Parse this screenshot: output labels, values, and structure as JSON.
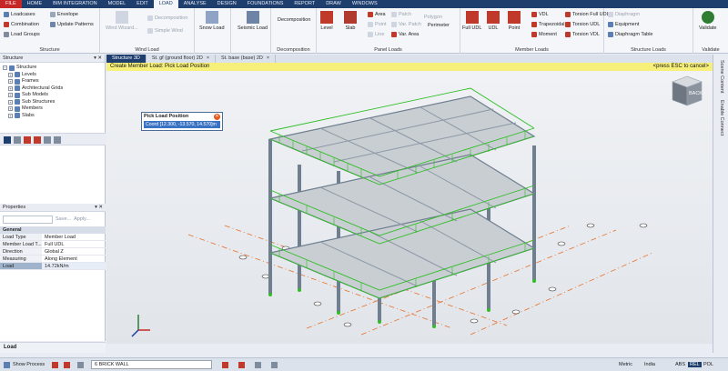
{
  "menu": [
    "FILE",
    "HOME",
    "BIM INTEGRATION",
    "MODEL",
    "EDIT",
    "LOAD",
    "ANALYSE",
    "DESIGN",
    "FOUNDATIONS",
    "REPORT",
    "DRAW",
    "WINDOWS"
  ],
  "ribbon": {
    "structure": {
      "title": "Structure",
      "items": [
        "Loadcases",
        "Combination",
        "Load Groups",
        "Envelope",
        "Update Patterns"
      ]
    },
    "wind": {
      "title": "Wind Load",
      "items": [
        "Wind Wizard...",
        "Decomposition",
        "Simple Wind"
      ]
    },
    "snow": {
      "label": "Snow Load"
    },
    "seismic": {
      "label": "Seismic Load"
    },
    "decomp": {
      "title": "Decomposition",
      "label": "Decomposition"
    },
    "panel": {
      "title": "Panel Loads",
      "items": [
        "Level",
        "Slab",
        "Area",
        "Point",
        "Line",
        "Patch",
        "Var. Patch",
        "Var. Area",
        "Polygon",
        "Perimeter"
      ]
    },
    "member": {
      "title": "Member Loads",
      "items": [
        "Full UDL",
        "UDL",
        "Point",
        "VDL",
        "Trapezoidal",
        "Moment",
        "Torsion Full UDL",
        "Torsion UDL",
        "Torsion VDL"
      ]
    },
    "struct_loads": {
      "title": "Structure Loads",
      "items": [
        "Diaphragm",
        "Equipment",
        "Diaphragm Table"
      ]
    },
    "validate": {
      "title": "Validate",
      "label": "Validate"
    }
  },
  "left": {
    "structure_title": "Structure",
    "tree": [
      "Structure",
      "Levels",
      "Frames",
      "Architectural Grids",
      "Sub Models",
      "Sub Structures",
      "Members",
      "Slabs"
    ],
    "properties_title": "Properties",
    "save": "Save...",
    "apply": "Apply...",
    "general": "General",
    "props": [
      [
        "Load Type",
        "Member Load"
      ],
      [
        "Member Load T...",
        "Full UDL"
      ],
      [
        "Direction",
        "Global Z"
      ],
      [
        "Measuring",
        "Along Element"
      ],
      [
        "Load",
        "14.72kN/m"
      ]
    ],
    "load_label": "Load"
  },
  "doc_tabs": [
    "Structure 3D",
    "St. gf (ground floor) 2D",
    "St. base (base) 2D"
  ],
  "infobar": {
    "left": "Create Member Load: Pick Load Position",
    "right": "<press ESC to cancel>"
  },
  "pick": {
    "title": "Pick Load Position",
    "coord": "Coord [12.300, -13.570, 14.570]m"
  },
  "navcube": "BACK",
  "right_tabs": [
    "Scene Content",
    "Enable Connect"
  ],
  "status": {
    "show_process": "Show Process",
    "field": "6 BRICK WALL",
    "metric": "Metric",
    "region": "India",
    "abs": "ABS",
    "rel": "REL",
    "pol": "POL"
  },
  "colors": {
    "accent": "#1e3e6e",
    "load": "#2fbe24",
    "beam": "#7a8a9a",
    "file_tab": "#c62828",
    "info": "#f6ef7a"
  }
}
